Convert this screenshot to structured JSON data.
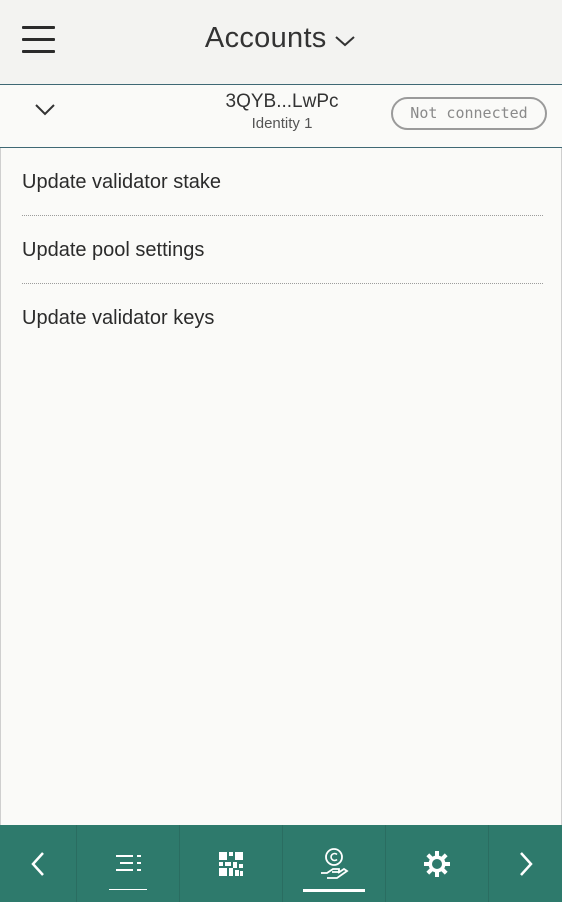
{
  "header": {
    "title": "Accounts",
    "menu_icon": "hamburger-menu-icon",
    "dropdown_icon": "chevron-down-icon"
  },
  "account": {
    "address": "3QYB...LwPc",
    "identity": "Identity 1",
    "status": "Not connected",
    "expand_icon": "chevron-down-icon"
  },
  "menu": {
    "items": [
      {
        "label": "Update validator stake"
      },
      {
        "label": "Update pool settings"
      },
      {
        "label": "Update validator keys"
      }
    ]
  },
  "bottom_nav": {
    "items": [
      {
        "icon": "chevron-left-icon",
        "active": false
      },
      {
        "icon": "list-icon",
        "active": false
      },
      {
        "icon": "qr-code-icon",
        "active": false
      },
      {
        "icon": "hand-coin-icon",
        "active": true
      },
      {
        "icon": "gear-icon",
        "active": false
      },
      {
        "icon": "chevron-right-icon",
        "active": false
      }
    ]
  },
  "colors": {
    "accent": "#2e7a6c",
    "divider": "#3e6874",
    "background": "#fafaf8",
    "header_background": "#f3f3f1"
  }
}
